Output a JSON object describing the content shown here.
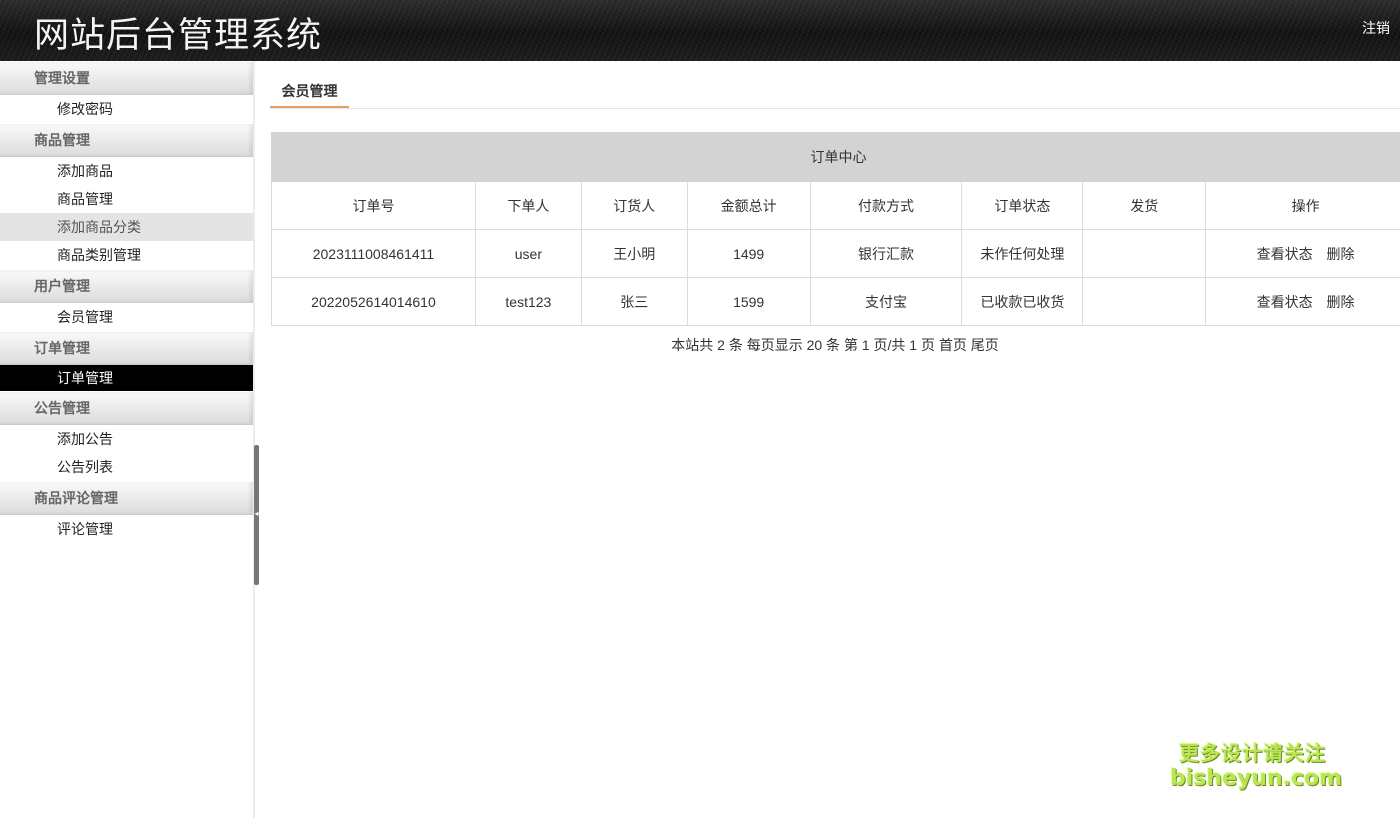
{
  "header": {
    "title": "网站后台管理系统",
    "logout": "注销"
  },
  "sidebar": {
    "groups": [
      {
        "label": "管理设置",
        "items": [
          "修改密码"
        ]
      },
      {
        "label": "商品管理",
        "items": [
          "添加商品",
          "商品管理",
          "添加商品分类",
          "商品类别管理"
        ]
      },
      {
        "label": "用户管理",
        "items": [
          "会员管理"
        ]
      },
      {
        "label": "订单管理",
        "items": [
          "订单管理"
        ]
      },
      {
        "label": "公告管理",
        "items": [
          "添加公告",
          "公告列表"
        ]
      },
      {
        "label": "商品评论管理",
        "items": [
          "评论管理"
        ]
      }
    ]
  },
  "main": {
    "tab": "会员管理",
    "table": {
      "caption": "订单中心",
      "headers": [
        "订单号",
        "下单人",
        "订货人",
        "金额总计",
        "付款方式",
        "订单状态",
        "发货",
        "操作"
      ],
      "rows": [
        {
          "order_no": "2023111008461411",
          "placer": "user",
          "receiver": "王小明",
          "total": "1499",
          "payment": "银行汇款",
          "status": "未作任何处理",
          "shipping": "",
          "view": "查看状态",
          "delete": "删除"
        },
        {
          "order_no": "2022052614014610",
          "placer": "test123",
          "receiver": "张三",
          "total": "1599",
          "payment": "支付宝",
          "status": "已收款已收货",
          "shipping": "",
          "view": "查看状态",
          "delete": "删除"
        }
      ]
    },
    "pager": {
      "summary": "本站共  2 条 每页显示 20 条 第 1 页/共 1 页",
      "first": "首页",
      "last": "尾页"
    }
  },
  "watermark": {
    "line1": "更多设计请关注",
    "line2": "bisheyun.com"
  },
  "colors": {
    "header_bg": "#151515",
    "active_item_bg": "#000000",
    "tab_underline": "#e8a062",
    "caption_bg": "#d3d3d3",
    "watermark": "#b8e655"
  }
}
